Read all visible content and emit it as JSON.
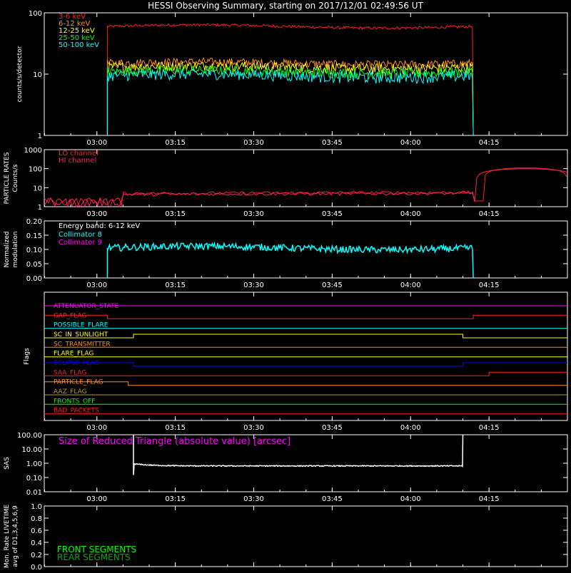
{
  "title": "HESSI Observing Summary, starting on 2017/12/01 02:49:56 UT",
  "time_ticks": [
    "03:00",
    "03:15",
    "03:30",
    "03:45",
    "04:00",
    "04:15"
  ],
  "chart_data": [
    {
      "type": "line",
      "panel": "count-rates",
      "ylabel": "counts/s/detector",
      "yscale": "log",
      "ylim": [
        1,
        100
      ],
      "yticks": [
        "1",
        "10",
        "100"
      ],
      "xrange": [
        "02:49:56",
        "04:30:00"
      ],
      "legend_placement": "top-left",
      "series": [
        {
          "name": "3-6 keV",
          "color": "#ff2020",
          "start": "03:02",
          "end": "04:12",
          "level": 60,
          "noise": 3
        },
        {
          "name": "6-12 keV",
          "color": "#ff8c1a",
          "start": "03:02",
          "end": "04:12",
          "level": 15,
          "noise": 2.5
        },
        {
          "name": "12-25 keV",
          "color": "#ffff00",
          "start": "03:02",
          "end": "04:12",
          "level": 13,
          "noise": 2.5
        },
        {
          "name": "25-50 keV",
          "color": "#00ff00",
          "start": "03:02",
          "end": "04:12",
          "level": 11,
          "noise": 2
        },
        {
          "name": "50-100 keV",
          "color": "#00ffff",
          "start": "03:02",
          "end": "04:12",
          "level": 9.5,
          "noise": 2
        }
      ]
    },
    {
      "type": "line",
      "panel": "particle-rates",
      "ylabel_1": "PARTICLE RATES",
      "ylabel_2": "Counts/s",
      "yscale": "log",
      "ylim": [
        1,
        1000
      ],
      "yticks": [
        "1",
        "10",
        "100",
        "1000"
      ],
      "series": [
        {
          "name": "LO channel",
          "color": "#ff2020"
        },
        {
          "name": "HI channel",
          "color": "#ff2060"
        }
      ],
      "peak_time": "04:22",
      "peak_value": 110
    },
    {
      "type": "line",
      "panel": "modulation",
      "ylabel_1": "Normalized",
      "ylabel_2": "modulation",
      "ylim": [
        0,
        0.2
      ],
      "yticks": [
        "0.00",
        "0.05",
        "0.10",
        "0.15",
        "0.20"
      ],
      "note": "Energy band: 6-12 keV",
      "series": [
        {
          "name": "Collimator 8",
          "color": "#00ffff",
          "start": "03:02",
          "end": "04:12",
          "level": 0.105
        },
        {
          "name": "Collimator 9",
          "color": "#ff00ff"
        }
      ]
    },
    {
      "type": "line",
      "panel": "flags",
      "ylabel": "Flags",
      "flags": [
        {
          "name": "ATTENUATOR_STATE",
          "color": "#ff00ff",
          "segments": [
            [
              "02:49:56",
              "04:30:00",
              1
            ]
          ]
        },
        {
          "name": "GAP_FLAG",
          "color": "#ff2020",
          "segments": [
            [
              "02:49:56",
              "03:02",
              1
            ],
            [
              "03:02",
              "04:12",
              0
            ],
            [
              "04:12",
              "04:30:00",
              1
            ]
          ]
        },
        {
          "name": "POSSIBLE_FLARE",
          "color": "#00ffff",
          "segments": [
            [
              "02:49:56",
              "04:30:00",
              0
            ]
          ]
        },
        {
          "name": "SC_IN_SUNLIGHT",
          "color": "#ffff00",
          "segments": [
            [
              "02:49:56",
              "03:07",
              0
            ],
            [
              "03:07",
              "04:10",
              1
            ],
            [
              "04:10",
              "04:30:00",
              0
            ]
          ]
        },
        {
          "name": "SC_TRANSMITTER",
          "color": "#ff8c1a",
          "segments": [
            [
              "02:49:56",
              "04:30:00",
              0
            ]
          ]
        },
        {
          "name": "FLARE_FLAG",
          "color": "#ffff00",
          "segments": [
            [
              "02:49:56",
              "04:30:00",
              0
            ]
          ]
        },
        {
          "name": "ECLIPSE_FLAG",
          "color": "#0000ff",
          "segments": [
            [
              "02:49:56",
              "03:07",
              1
            ],
            [
              "03:07",
              "04:10",
              0
            ],
            [
              "04:10",
              "04:30:00",
              1
            ]
          ]
        },
        {
          "name": "SAA_FLAG",
          "color": "#ff2020",
          "segments": [
            [
              "02:49:56",
              "04:15",
              0
            ],
            [
              "04:15",
              "04:30:00",
              1
            ]
          ]
        },
        {
          "name": "PARTICLE_FLAG",
          "color": "#ff8c1a",
          "segments": [
            [
              "02:49:56",
              "03:06",
              1
            ],
            [
              "03:06",
              "04:30:00",
              0
            ]
          ]
        },
        {
          "name": "AAZ_FLAG",
          "color": "#b8a000",
          "segments": [
            [
              "02:49:56",
              "04:30:00",
              0
            ]
          ]
        },
        {
          "name": "FRONTS_OFF",
          "color": "#00ff00",
          "segments": [
            [
              "02:49:56",
              "04:30:00",
              0
            ]
          ]
        },
        {
          "name": "BAD_PACKETS",
          "color": "#ff2020",
          "segments": [
            [
              "02:49:56",
              "04:30:00",
              0
            ]
          ]
        }
      ]
    },
    {
      "type": "line",
      "panel": "sas",
      "ylabel": "SAS",
      "yscale": "log",
      "ylim": [
        0.01,
        100
      ],
      "yticks": [
        "0.01",
        "0.10",
        "1.00",
        "10.00",
        "100.00"
      ],
      "note": "Size of Reduced Triangle (absolute value) [arcsec]",
      "series": [
        {
          "name": "",
          "color": "#ffffff",
          "start": "03:07",
          "end": "04:10",
          "level": 0.65
        }
      ]
    },
    {
      "type": "line",
      "panel": "livetime",
      "ylabel_1": "Mon. Rate LIVETIME",
      "ylabel_2": "avg of D1,3,4,5,6,9",
      "ylim": [
        0,
        1
      ],
      "yticks": [
        "0.0",
        "0.2",
        "0.4",
        "0.6",
        "0.8",
        "1.0"
      ],
      "series": [
        {
          "name": "FRONT SEGMENTS",
          "color": "#00ff00"
        },
        {
          "name": "REAR SEGMENTS",
          "color": "#00aa00"
        }
      ]
    }
  ]
}
